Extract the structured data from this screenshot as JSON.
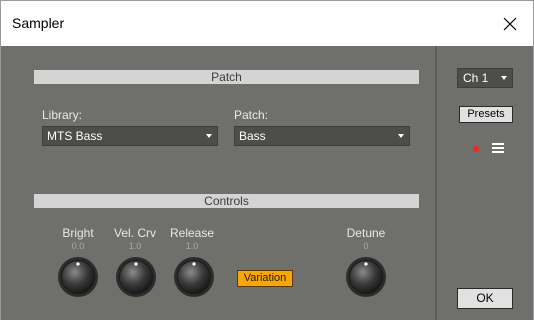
{
  "window": {
    "title": "Sampler"
  },
  "patch_section": {
    "header": "Patch"
  },
  "library": {
    "label": "Library:",
    "value": "MTS Bass"
  },
  "patch": {
    "label": "Patch:",
    "value": "Bass"
  },
  "controls_section": {
    "header": "Controls"
  },
  "knobs": [
    {
      "label": "Bright",
      "value": "0.0"
    },
    {
      "label": "Vel. Crv",
      "value": "1.0"
    },
    {
      "label": "Release",
      "value": "1.0"
    },
    {
      "label": "Detune",
      "value": "0"
    }
  ],
  "variation_button": {
    "label": "Variation"
  },
  "channel": {
    "value": "Ch 1"
  },
  "presets_button": {
    "label": "Presets"
  },
  "ok_button": {
    "label": "OK"
  },
  "colors": {
    "panel_bg": "#6f706b",
    "section_bar": "#d4d4d4",
    "variation_accent": "#f5a70a",
    "record_indicator": "#ff2020"
  },
  "icons": {
    "close": "close-icon",
    "record": "record-dot-icon",
    "menu": "hamburger-menu-icon"
  }
}
